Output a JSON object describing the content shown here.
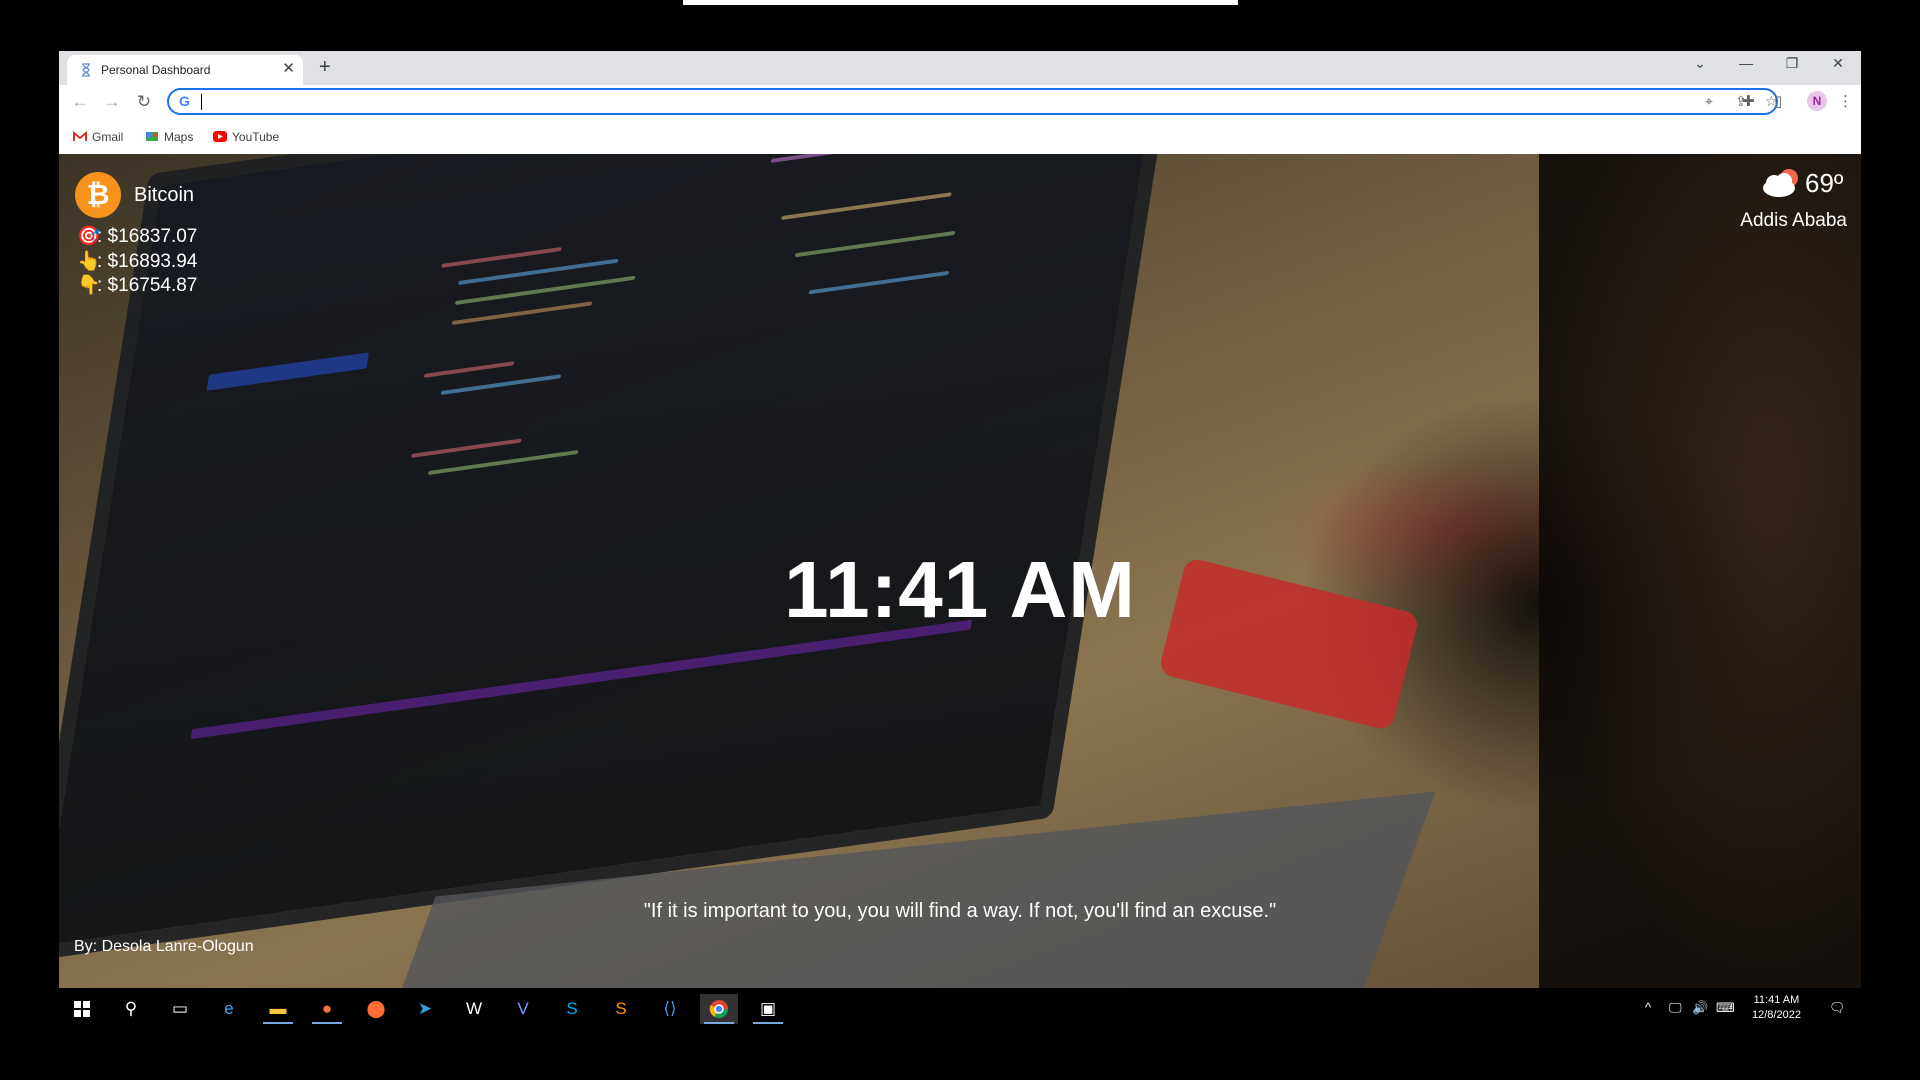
{
  "browser": {
    "tab_title": "Personal Dashboard",
    "tab_close": "✕",
    "new_tab": "+",
    "window_controls": {
      "down": "⌄",
      "minimize": "—",
      "restore": "❐",
      "close": "✕"
    },
    "address_value": "",
    "bookmarks": [
      {
        "label": "Gmail",
        "icon": "gmail-icon",
        "color": "#d93025"
      },
      {
        "label": "Maps",
        "icon": "maps-icon",
        "color": "#34a853"
      },
      {
        "label": "YouTube",
        "icon": "youtube-icon",
        "color": "#ff0000"
      }
    ],
    "profile_initial": "N"
  },
  "dashboard": {
    "crypto": {
      "name": "Bitcoin",
      "symbol_glyph": "₿",
      "current": ": $16837.07",
      "high": ": $16893.94",
      "low": ": $16754.87"
    },
    "weather": {
      "temperature": "69º",
      "city": "Addis Ababa"
    },
    "time": "11:41 AM",
    "quote": "\"If it is important to you, you will find a way. If not, you'll find an excuse.\"",
    "author": "By: Desola Lanre-Ologun"
  },
  "taskbar": {
    "clock_time": "11:41 AM",
    "clock_date": "12/8/2022",
    "apps": [
      "start",
      "search",
      "task-view",
      "edge",
      "file-explorer",
      "firefox",
      "postman",
      "telegram",
      "word",
      "vscode-insiders-v",
      "skype",
      "sublime",
      "vscode",
      "chrome",
      "terminal"
    ]
  },
  "colors": {
    "bitcoin_orange": "#f7931a",
    "omnibox_focus": "#1a73e8"
  }
}
